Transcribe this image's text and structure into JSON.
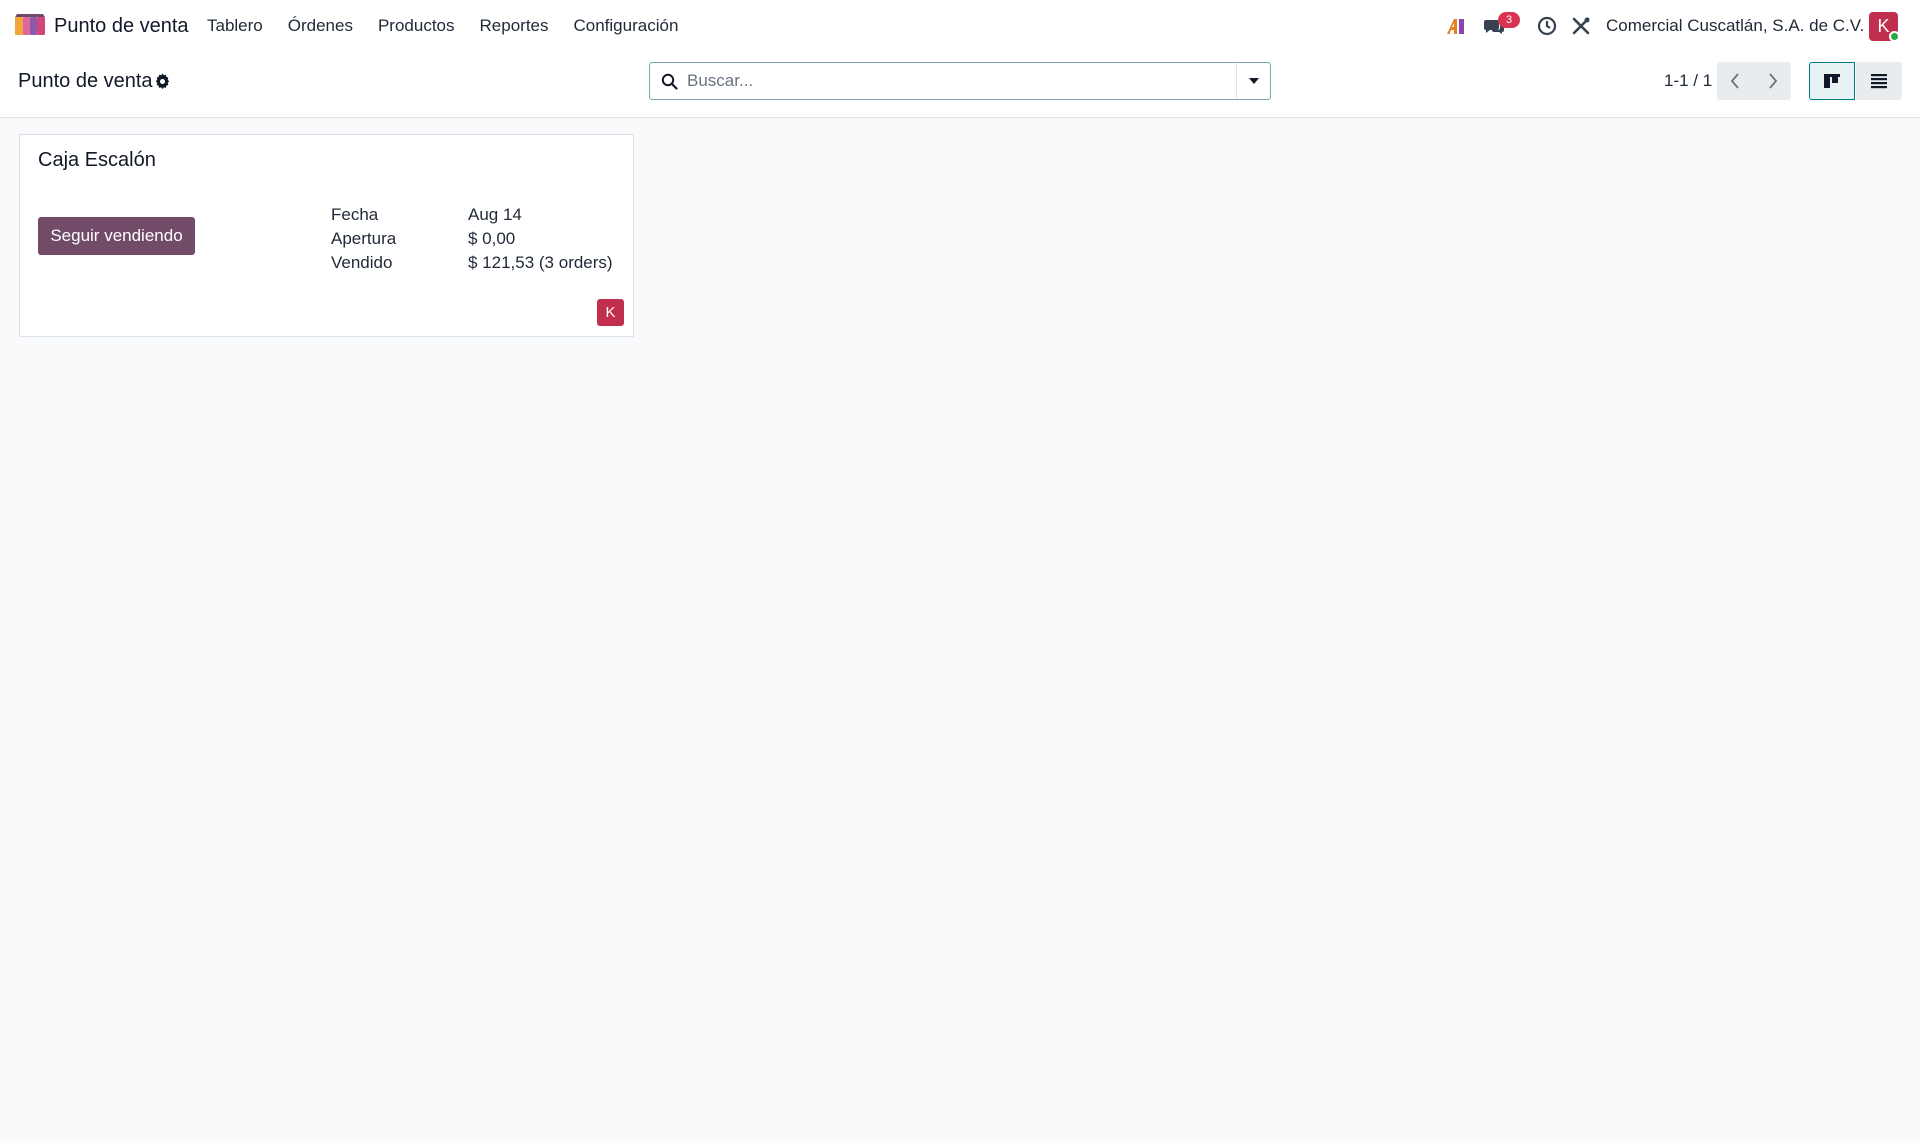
{
  "navbar": {
    "app_name": "Punto de venta",
    "menu": [
      "Tablero",
      "Órdenes",
      "Productos",
      "Reportes",
      "Configuración"
    ],
    "messages_badge": "3",
    "company": "Comercial Cuscatlán, S.A. de C.V.",
    "avatar_initial": "K",
    "icons": [
      "app-logo-icon",
      "ai-assistant-icon",
      "messages-icon",
      "activity-clock-icon",
      "tools-icon"
    ]
  },
  "control": {
    "breadcrumb": "Punto de venta",
    "search_placeholder": "Buscar...",
    "pager": "1-1 / 1"
  },
  "card": {
    "title": "Caja Escalón",
    "button_label": "Seguir vendiendo",
    "rows": [
      {
        "label": "Fecha",
        "value": "Aug 14"
      },
      {
        "label": "Apertura",
        "value": "$ 0,00"
      },
      {
        "label": "Vendido",
        "value": "$ 121,53 (3 orders)"
      }
    ],
    "avatar_initial": "K"
  },
  "colors": {
    "brand": "#714b67",
    "accent": "#017e84",
    "avatar": "#c0304e",
    "badge": "#d9344f"
  }
}
